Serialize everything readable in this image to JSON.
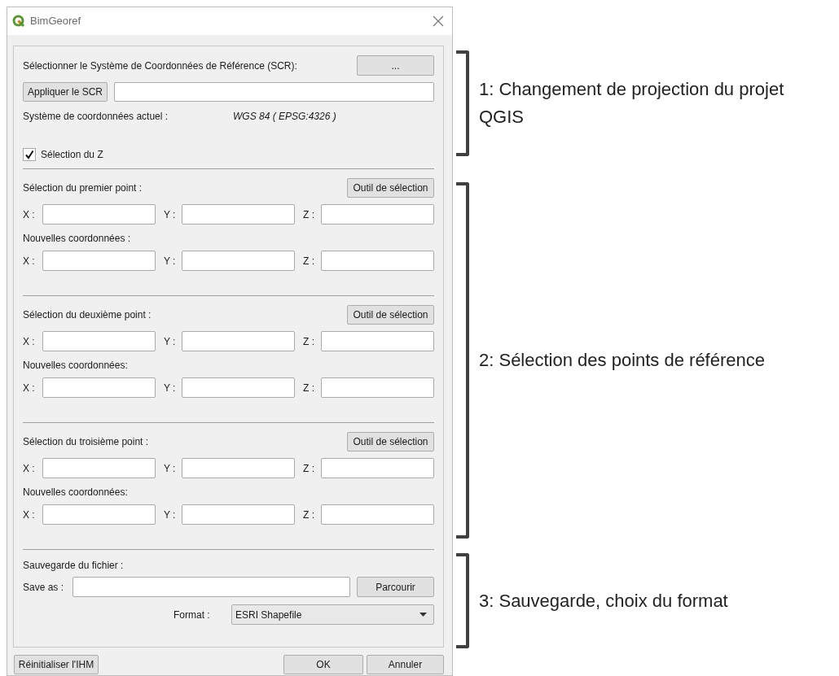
{
  "window": {
    "title": "BimGeoref"
  },
  "crs": {
    "label": "Sélectionner le Système de Coordonnées de Référence (SCR):",
    "browse_button": "...",
    "apply_button": "Appliquer le SCR",
    "current_label": "Système de coordonnées actuel :",
    "current_value": "WGS 84 ( EPSG:4326 )",
    "z_checkbox": {
      "label": "Sélection du Z",
      "checked": true
    }
  },
  "points": [
    {
      "label": "Sélection du premier point :",
      "tool_button": "Outil de sélection",
      "fields": [
        "X :",
        "Y :",
        "Z :"
      ],
      "new_label": "Nouvelles coordonnées :",
      "new_fields": [
        "X :",
        "Y :",
        "Z :"
      ]
    },
    {
      "label": "Sélection du deuxième point :",
      "tool_button": "Outil de sélection",
      "fields": [
        "X :",
        "Y :",
        "Z :"
      ],
      "new_label": "Nouvelles coordonnées:",
      "new_fields": [
        "X :",
        "Y :",
        "Z :"
      ]
    },
    {
      "label": "Sélection du troisième point :",
      "tool_button": "Outil de sélection",
      "fields": [
        "X :",
        "Y :",
        "Z :"
      ],
      "new_label": "Nouvelles coordonnées:",
      "new_fields": [
        "X :",
        "Y :",
        "Z :"
      ]
    }
  ],
  "save": {
    "label": "Sauvegarde du fichier :",
    "save_as_label": "Save as :",
    "browse_button": "Parcourir",
    "format_label": "Format :",
    "format_value": "ESRI Shapefile"
  },
  "footer": {
    "reset_button": "Réinitialiser l'IHM",
    "ok_button": "OK",
    "cancel_button": "Annuler"
  },
  "annotations": [
    {
      "text": "1: Changement de projection du projet QGIS"
    },
    {
      "text": "2: Sélection des points de référence"
    },
    {
      "text": "3: Sauvegarde, choix du format"
    }
  ]
}
